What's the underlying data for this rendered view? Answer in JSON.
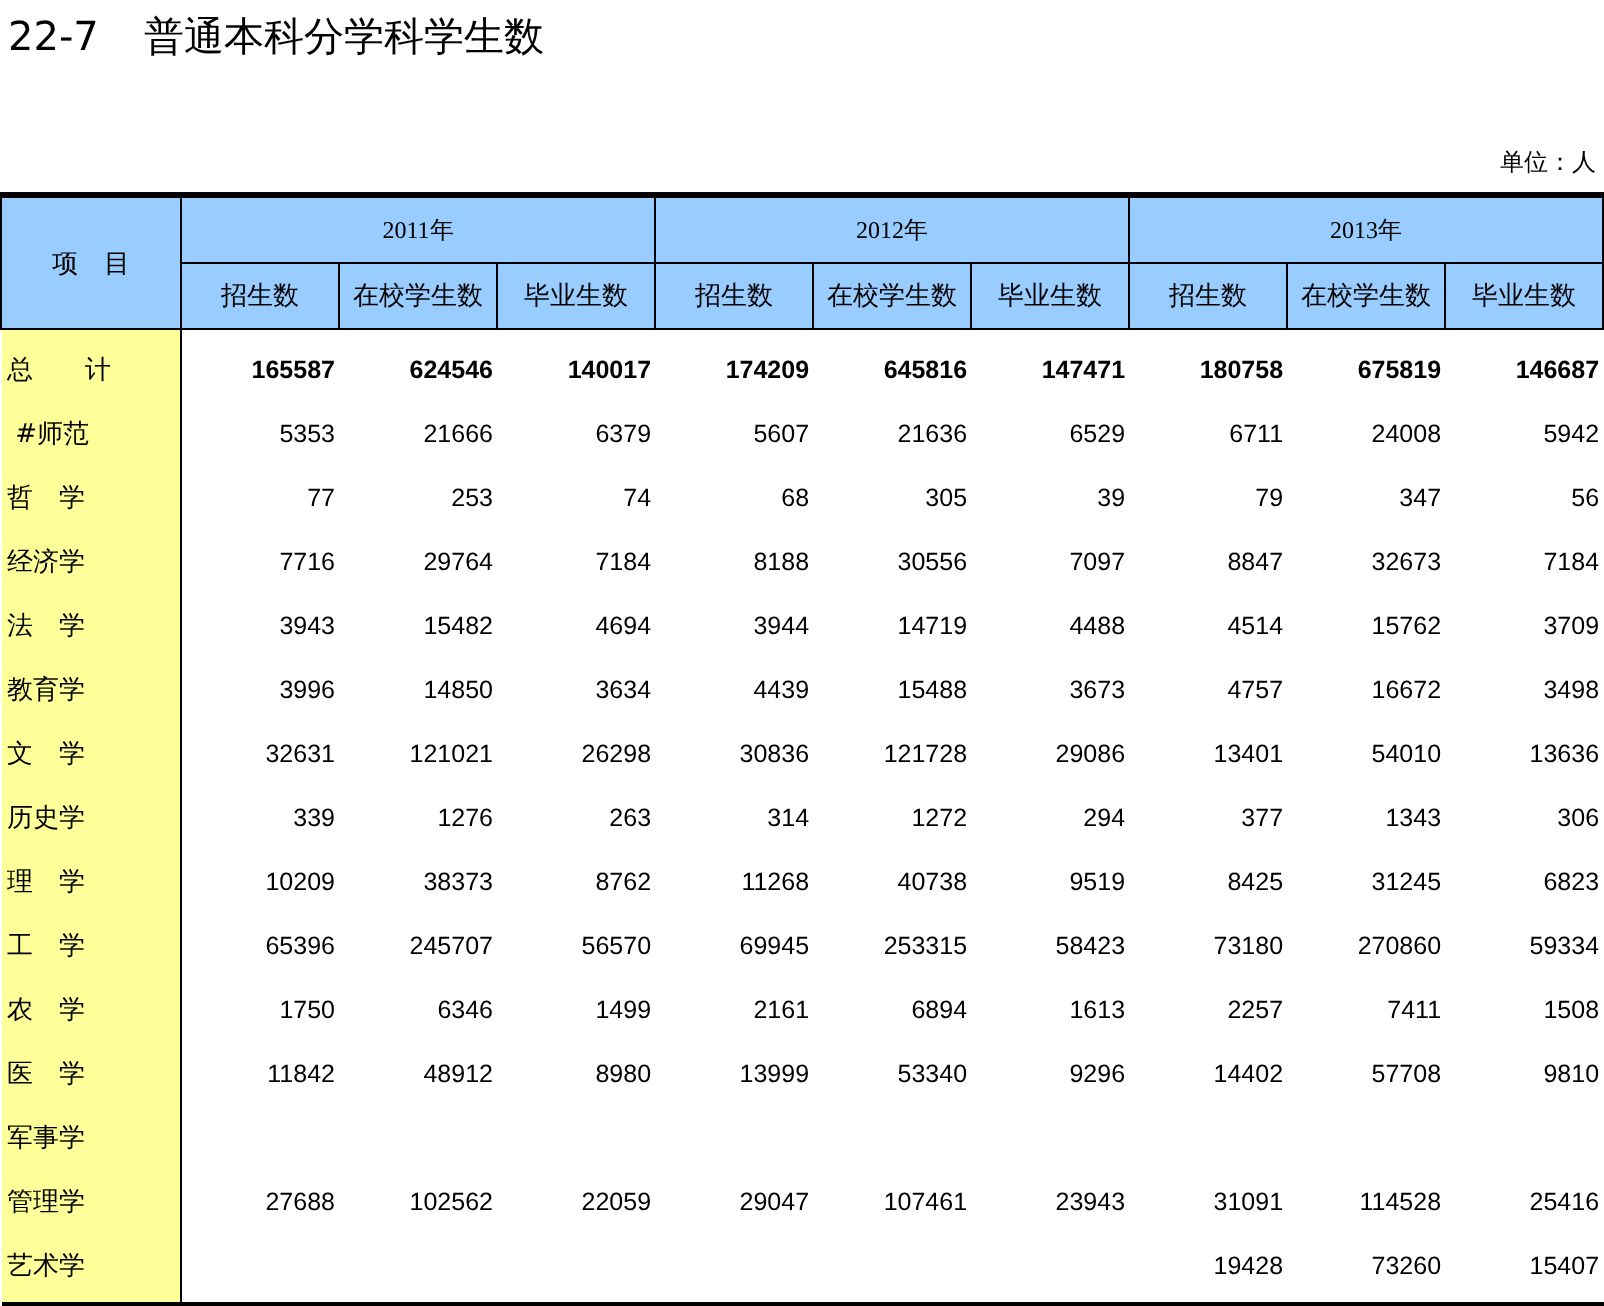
{
  "title": {
    "number": "22-7",
    "text": "普通本科分学科学生数"
  },
  "unit": "单位：人",
  "table": {
    "row_header": "项　目",
    "years": [
      "2011年",
      "2012年",
      "2013年"
    ],
    "columns": [
      "招生数",
      "在校学生数",
      "毕业生数",
      "招生数",
      "在校学生数",
      "毕业生数",
      "招生数",
      "在校学生数",
      "毕业生数"
    ],
    "rows": [
      {
        "kind": "total",
        "label": "总　　计",
        "values": [
          "165587",
          "624546",
          "140017",
          "174209",
          "645816",
          "147471",
          "180758",
          "675819",
          "146687"
        ]
      },
      {
        "kind": "item",
        "label": " #师范",
        "values": [
          "5353",
          "21666",
          "6379",
          "5607",
          "21636",
          "6529",
          "6711",
          "24008",
          "5942"
        ]
      },
      {
        "kind": "item",
        "label": "哲　学",
        "values": [
          "77",
          "253",
          "74",
          "68",
          "305",
          "39",
          "79",
          "347",
          "56"
        ]
      },
      {
        "kind": "item",
        "label": "经济学",
        "values": [
          "7716",
          "29764",
          "7184",
          "8188",
          "30556",
          "7097",
          "8847",
          "32673",
          "7184"
        ]
      },
      {
        "kind": "item",
        "label": "法　学",
        "values": [
          "3943",
          "15482",
          "4694",
          "3944",
          "14719",
          "4488",
          "4514",
          "15762",
          "3709"
        ]
      },
      {
        "kind": "item",
        "label": "教育学",
        "values": [
          "3996",
          "14850",
          "3634",
          "4439",
          "15488",
          "3673",
          "4757",
          "16672",
          "3498"
        ]
      },
      {
        "kind": "item",
        "label": "文　学",
        "values": [
          "32631",
          "121021",
          "26298",
          "30836",
          "121728",
          "29086",
          "13401",
          "54010",
          "13636"
        ]
      },
      {
        "kind": "item",
        "label": "历史学",
        "values": [
          "339",
          "1276",
          "263",
          "314",
          "1272",
          "294",
          "377",
          "1343",
          "306"
        ]
      },
      {
        "kind": "item",
        "label": "理　学",
        "values": [
          "10209",
          "38373",
          "8762",
          "11268",
          "40738",
          "9519",
          "8425",
          "31245",
          "6823"
        ]
      },
      {
        "kind": "item",
        "label": "工　学",
        "values": [
          "65396",
          "245707",
          "56570",
          "69945",
          "253315",
          "58423",
          "73180",
          "270860",
          "59334"
        ]
      },
      {
        "kind": "item",
        "label": "农　学",
        "values": [
          "1750",
          "6346",
          "1499",
          "2161",
          "6894",
          "1613",
          "2257",
          "7411",
          "1508"
        ]
      },
      {
        "kind": "item",
        "label": "医　学",
        "values": [
          "11842",
          "48912",
          "8980",
          "13999",
          "53340",
          "9296",
          "14402",
          "57708",
          "9810"
        ]
      },
      {
        "kind": "item",
        "label": "军事学"
      },
      {
        "kind": "item",
        "label": "管理学",
        "values": [
          "27688",
          "102562",
          "22059",
          "29047",
          "107461",
          "23943",
          "31091",
          "114528",
          "25416"
        ]
      },
      {
        "kind": "item",
        "label": "艺术学",
        "values": [
          "19428",
          "73260",
          "15407"
        ]
      }
    ]
  }
}
